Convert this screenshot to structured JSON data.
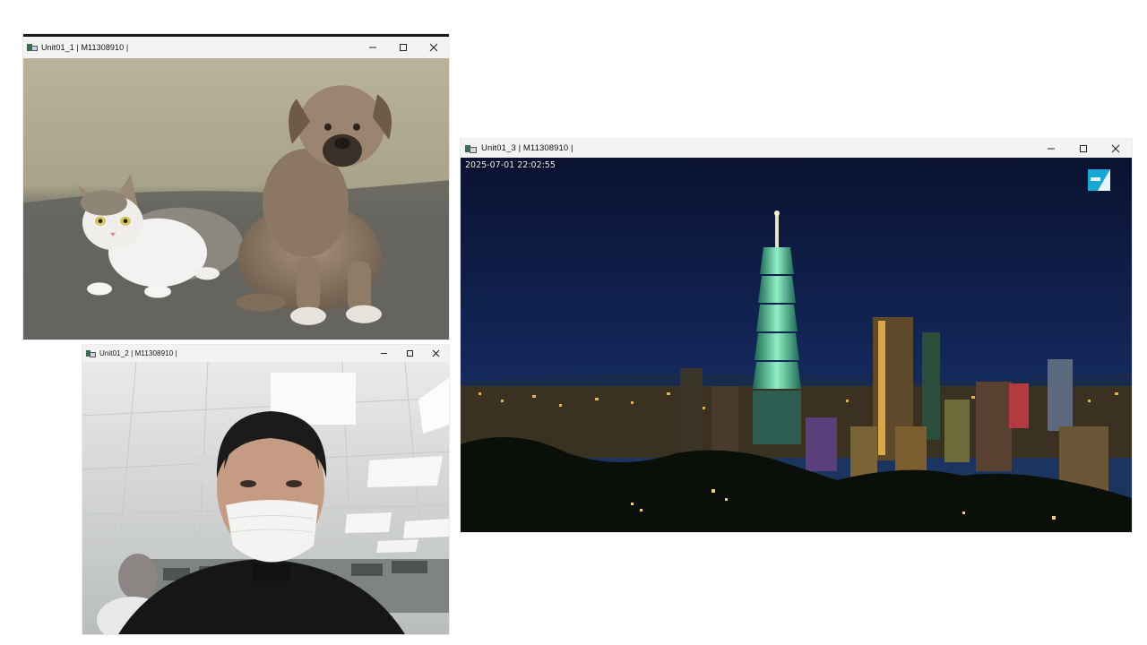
{
  "windows": [
    {
      "title": "Unit01_1 | M11308910 |",
      "image": "cat-and-puppy-photo"
    },
    {
      "title": "Unit01_2 | M11308910 |",
      "image": "webcam-person-with-mask"
    },
    {
      "title": "Unit01_3 | M11308910 |",
      "image": "taipei-night-skyline",
      "timestamp": "2025-07-01 22:02:55",
      "logo_icon": "channel-logo-icon"
    }
  ],
  "icons": {
    "minimize": "minimize-icon",
    "maximize": "maximize-icon",
    "close": "close-icon",
    "app": "opencv-window-icon"
  },
  "colors": {
    "titlebar": "#f3f3f3",
    "logo": "#19a7d6"
  }
}
